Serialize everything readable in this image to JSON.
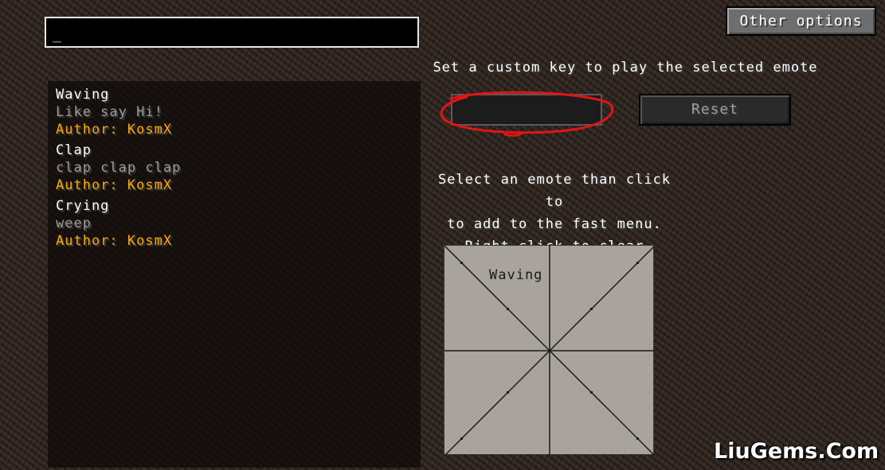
{
  "search": {
    "value": "_"
  },
  "emotes": [
    {
      "name": "Waving",
      "description": "Like say Hi!",
      "author": "Author: KosmX"
    },
    {
      "name": "Clap",
      "description": "clap clap clap",
      "author": "Author: KosmX"
    },
    {
      "name": "Crying",
      "description": "weep",
      "author": "Author: KosmX"
    }
  ],
  "header": {
    "other_options_label": "Other options"
  },
  "keybind": {
    "label": "Set a custom key to play the selected emote",
    "key_value": "",
    "reset_label": "Reset"
  },
  "fast_menu": {
    "instructions": [
      "Select an emote than click to",
      "to add to the fast menu.",
      "Right click to clear"
    ],
    "slots": [
      {
        "label": "Waving"
      }
    ]
  },
  "watermark": "LiuGems.Com",
  "colors": {
    "author": "#ffaa00",
    "description": "#9d9d9d",
    "annotation": "#e01515"
  }
}
